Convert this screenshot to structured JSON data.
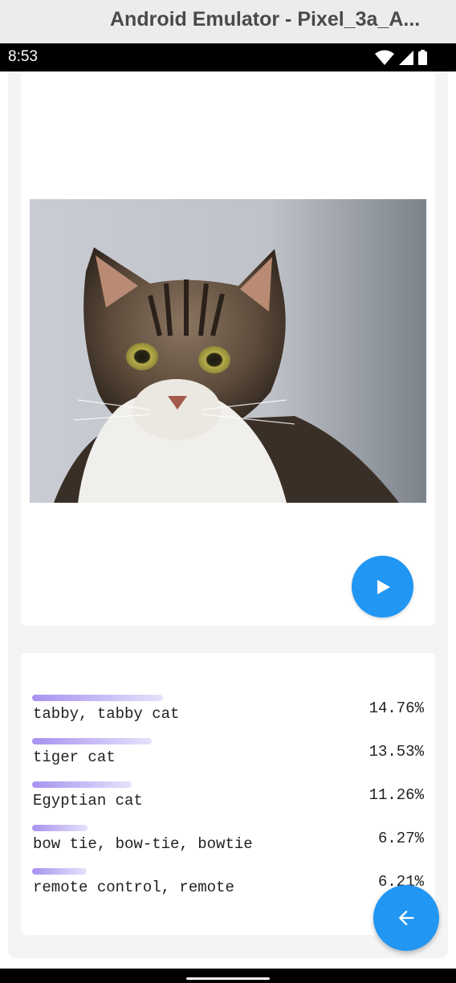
{
  "window": {
    "title": "Android Emulator - Pixel_3a_A..."
  },
  "statusbar": {
    "time": "8:53",
    "icons": [
      "wifi-icon",
      "signal-icon",
      "battery-icon"
    ]
  },
  "image_card": {
    "image_subject": "tabby cat photo",
    "play_icon": "play-icon",
    "accent": "#2196f3"
  },
  "predictions": {
    "items": [
      {
        "label": "tabby, tabby cat",
        "percent": "14.76%",
        "value": 14.76
      },
      {
        "label": "tiger cat",
        "percent": "13.53%",
        "value": 13.53
      },
      {
        "label": "Egyptian cat",
        "percent": "11.26%",
        "value": 11.26
      },
      {
        "label": "bow tie, bow-tie, bowtie",
        "percent": "6.27%",
        "value": 6.27
      },
      {
        "label": "remote control, remote",
        "percent": "6.21%",
        "value": 6.21
      }
    ]
  },
  "fab": {
    "icon": "arrow-back-icon"
  }
}
